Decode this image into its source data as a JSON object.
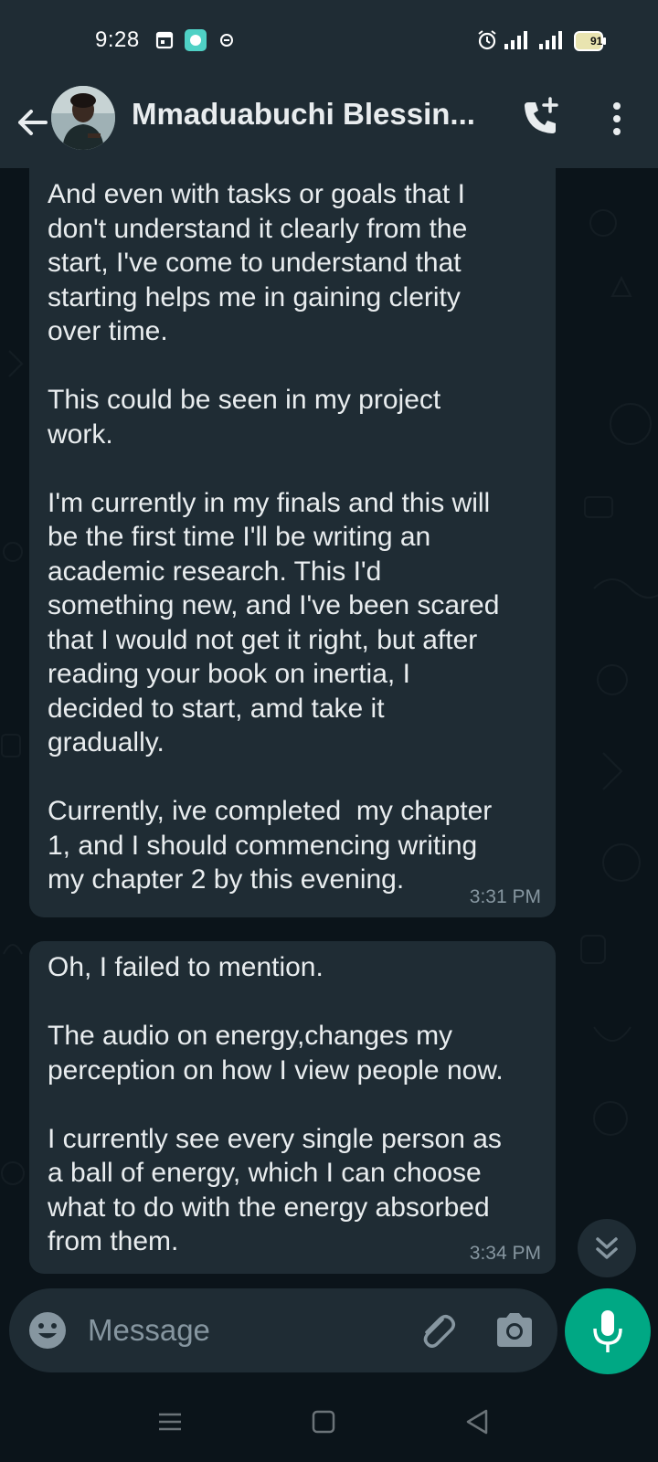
{
  "status_bar": {
    "time": "9:28",
    "battery": "91",
    "icons": [
      "calendar-icon",
      "chat-app-icon",
      "notification-icon",
      "alarm-icon",
      "signal-icon",
      "signal-icon",
      "battery-icon"
    ]
  },
  "header": {
    "contact_name": "Mmaduabuchi Blessin...",
    "back_icon": "arrow-left-icon",
    "call_icon": "add-call-icon",
    "menu_icon": "more-vert-icon"
  },
  "messages": [
    {
      "text": "And even with tasks or goals that I\ndon't understand it clearly from the\nstart, I've come to understand that\nstarting helps me in gaining clerity\nover time.\n\nThis could be seen in my project\nwork.\n\nI'm currently in my finals and this will\nbe the first time I'll be writing an\nacademic research. This I'd\nsomething new, and I've been scared\nthat I would not get it right, but after\nreading your book on inertia, I\ndecided to start, amd take it\ngradually.\n\nCurrently, ive completed  my chapter\n1, and I should commencing writing\nmy chapter 2 by this evening.",
      "time": "3:31 PM"
    },
    {
      "text": "Oh, I failed to mention.\n\nThe audio on energy,changes my\nperception on how I view people now.\n\nI currently see every single person as\na ball of energy, which I can choose\nwhat to do with the energy absorbed\nfrom them.",
      "time": "3:34 PM"
    }
  ],
  "input": {
    "placeholder": "Message",
    "value": ""
  },
  "colors": {
    "background": "#0b141a",
    "bar": "#1f2c34",
    "accent": "#00a884",
    "secondary_text": "#8696a0"
  }
}
